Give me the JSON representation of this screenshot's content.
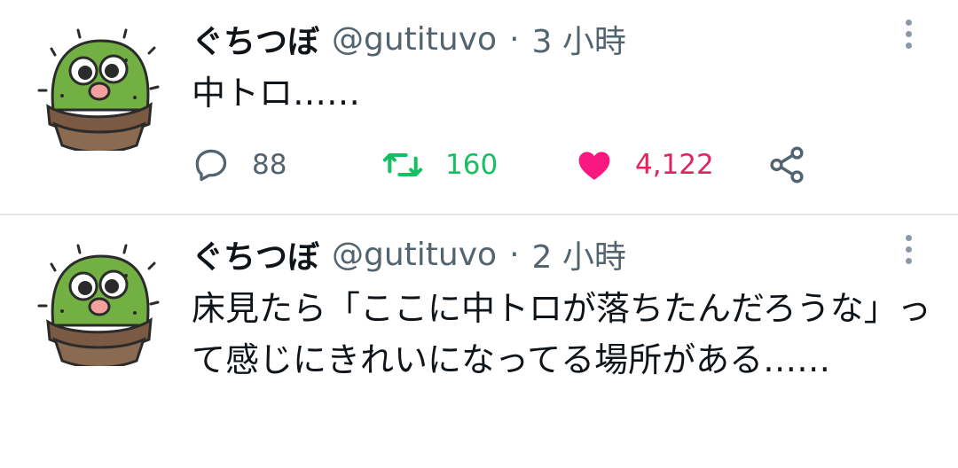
{
  "tweets": [
    {
      "name": "ぐちつぼ",
      "handle": "@gutituvo",
      "separator": "·",
      "time": "3 小時",
      "text": "中トロ……",
      "replies": "88",
      "retweets": "160",
      "likes": "4,122",
      "liked": true,
      "retweeted": true
    },
    {
      "name": "ぐちつぼ",
      "handle": "@gutituvo",
      "separator": "·",
      "time": "2 小時",
      "text": "床見たら「ここに中トロが落ちたんだろうな」って感じにきれいになってる場所がある……"
    }
  ],
  "icons": {
    "avatar": "cactus-avatar-icon",
    "more": "more-vertical-icon",
    "reply": "reply-icon",
    "retweet": "retweet-icon",
    "like": "heart-icon",
    "share": "share-icon"
  },
  "colors": {
    "text": "#0f1419",
    "secondary": "#536471",
    "retweet": "#17bf63",
    "like": "#e0245e",
    "divider": "#e4e6e8"
  }
}
